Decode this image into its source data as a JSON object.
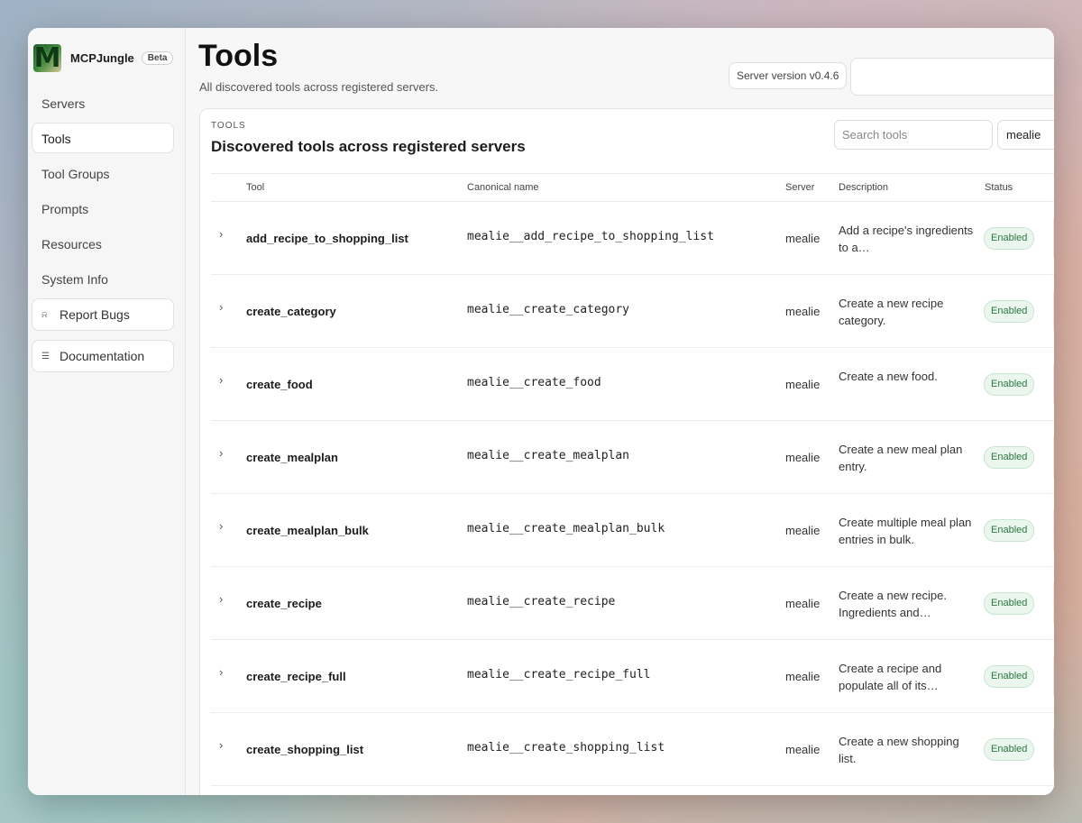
{
  "app": {
    "name": "MCPJungle",
    "badge": "Beta",
    "logo_letter": "M"
  },
  "sidebar": {
    "items": [
      {
        "label": "Servers",
        "active": false
      },
      {
        "label": "Tools",
        "active": true
      },
      {
        "label": "Tool Groups",
        "active": false
      },
      {
        "label": "Prompts",
        "active": false
      },
      {
        "label": "Resources",
        "active": false
      },
      {
        "label": "System Info",
        "active": false
      }
    ],
    "cards": [
      {
        "label": "Report Bugs",
        "icon": "bell-icon"
      },
      {
        "label": "Documentation",
        "icon": "document-icon"
      }
    ]
  },
  "header": {
    "title": "Tools",
    "subtitle": "All discovered tools across registered servers.",
    "version": "Server version v0.4.6"
  },
  "tools_card": {
    "eyebrow": "TOOLS",
    "title": "Discovered tools across registered servers",
    "search_placeholder": "Search tools",
    "server_filter": "mealie"
  },
  "table": {
    "columns": {
      "tool": "Tool",
      "canonical": "Canonical name",
      "server": "Server",
      "description": "Description",
      "status": "Status"
    },
    "rows": [
      {
        "tool": "add_recipe_to_shopping_list",
        "canonical": "mealie__add_recipe_to_shopping_list",
        "server": "mealie",
        "description": "Add a recipe's ingredients to a…",
        "status": "Enabled"
      },
      {
        "tool": "create_category",
        "canonical": "mealie__create_category",
        "server": "mealie",
        "description": "Create a new recipe category.",
        "status": "Enabled"
      },
      {
        "tool": "create_food",
        "canonical": "mealie__create_food",
        "server": "mealie",
        "description": "Create a new food.",
        "status": "Enabled"
      },
      {
        "tool": "create_mealplan",
        "canonical": "mealie__create_mealplan",
        "server": "mealie",
        "description": "Create a new meal plan entry.",
        "status": "Enabled"
      },
      {
        "tool": "create_mealplan_bulk",
        "canonical": "mealie__create_mealplan_bulk",
        "server": "mealie",
        "description": "Create multiple meal plan entries in bulk.",
        "status": "Enabled"
      },
      {
        "tool": "create_recipe",
        "canonical": "mealie__create_recipe",
        "server": "mealie",
        "description": "Create a new recipe. Ingredients and…",
        "status": "Enabled"
      },
      {
        "tool": "create_recipe_full",
        "canonical": "mealie__create_recipe_full",
        "server": "mealie",
        "description": "Create a recipe and populate all of its…",
        "status": "Enabled"
      },
      {
        "tool": "create_shopping_list",
        "canonical": "mealie__create_shopping_list",
        "server": "mealie",
        "description": "Create a new shopping list.",
        "status": "Enabled"
      }
    ]
  }
}
